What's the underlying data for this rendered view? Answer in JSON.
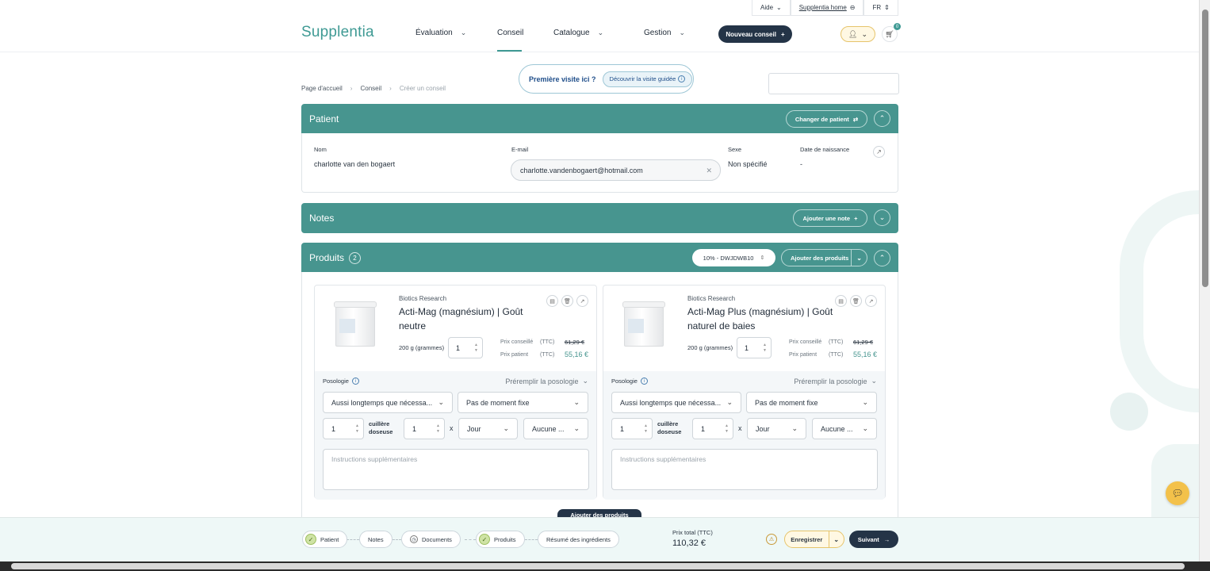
{
  "util_bar": {
    "help": "Aide",
    "home": "Supplentia home",
    "lang": "FR"
  },
  "header": {
    "logo": "Supplentia",
    "nav": [
      "Évaluation",
      "Conseil",
      "Catalogue",
      "Gestion"
    ],
    "active_nav": "Conseil",
    "new_button": "Nouveau conseil",
    "cart_count": "0"
  },
  "breadcrumb": [
    "Page d'accueil",
    "Conseil",
    "Créer un conseil"
  ],
  "first_visit": {
    "text": "Première visite ici ?",
    "button": "Découvrir la visite guidée"
  },
  "patient": {
    "title": "Patient",
    "change_button": "Changer de patient",
    "labels": {
      "name": "Nom",
      "email": "E-mail",
      "sex": "Sexe",
      "dob": "Date de naissance"
    },
    "name": "charlotte van den bogaert",
    "email": "charlotte.vandenbogaert@hotmail.com",
    "sex": "Non spécifié",
    "dob": "-"
  },
  "notes": {
    "title": "Notes",
    "add_button": "Ajouter une note"
  },
  "products": {
    "title": "Produits",
    "count": "2",
    "coupon": "10% - DWJDWB10",
    "add_button": "Ajouter des produits",
    "add_more_button": "Ajouter des produits",
    "items": [
      {
        "brand": "Biotics Research",
        "name": "Acti-Mag (magnésium) | Goût neutre",
        "qty_label": "200 g (grammes)",
        "qty": "1",
        "advised_label": "Prix conseillé",
        "patient_label": "Prix patient",
        "ttc": "(TTC)",
        "advised_price": "61,29 €",
        "patient_price": "55,16 €",
        "posology_label": "Posologie",
        "prefill": "Préremplir la posologie",
        "duration": "Aussi longtemps que nécessa...",
        "moment": "Pas de moment fixe",
        "dose_qty": "1",
        "dose_unit": "cuillère doseuse",
        "freq_qty": "1",
        "times": "x",
        "period": "Jour",
        "other": "Aucune ...",
        "instructions_placeholder": "Instructions supplémentaires"
      },
      {
        "brand": "Biotics Research",
        "name": "Acti-Mag Plus (magnésium) | Goût naturel de baies",
        "qty_label": "200 g (grammes)",
        "qty": "1",
        "advised_label": "Prix conseillé",
        "patient_label": "Prix patient",
        "ttc": "(TTC)",
        "advised_price": "61,29 €",
        "patient_price": "55,16 €",
        "posology_label": "Posologie",
        "prefill": "Préremplir la posologie",
        "duration": "Aussi longtemps que nécessa...",
        "moment": "Pas de moment fixe",
        "dose_qty": "1",
        "dose_unit": "cuillère doseuse",
        "freq_qty": "1",
        "times": "x",
        "period": "Jour",
        "other": "Aucune ...",
        "instructions_placeholder": "Instructions supplémentaires"
      }
    ]
  },
  "steps": [
    {
      "label": "Patient",
      "state": "done"
    },
    {
      "label": "Notes",
      "state": "none"
    },
    {
      "label": "Documents",
      "state": "pending"
    },
    {
      "label": "Produits",
      "state": "done"
    },
    {
      "label": "Résumé des ingrédients",
      "state": "none"
    }
  ],
  "total": {
    "label": "Prix total (TTC)",
    "value": "110,32 €"
  },
  "actions": {
    "save": "Enregistrer",
    "next": "Suivant"
  },
  "colors": {
    "accent": "#47958f",
    "dark": "#243447",
    "highlight": "#f3c14a"
  }
}
